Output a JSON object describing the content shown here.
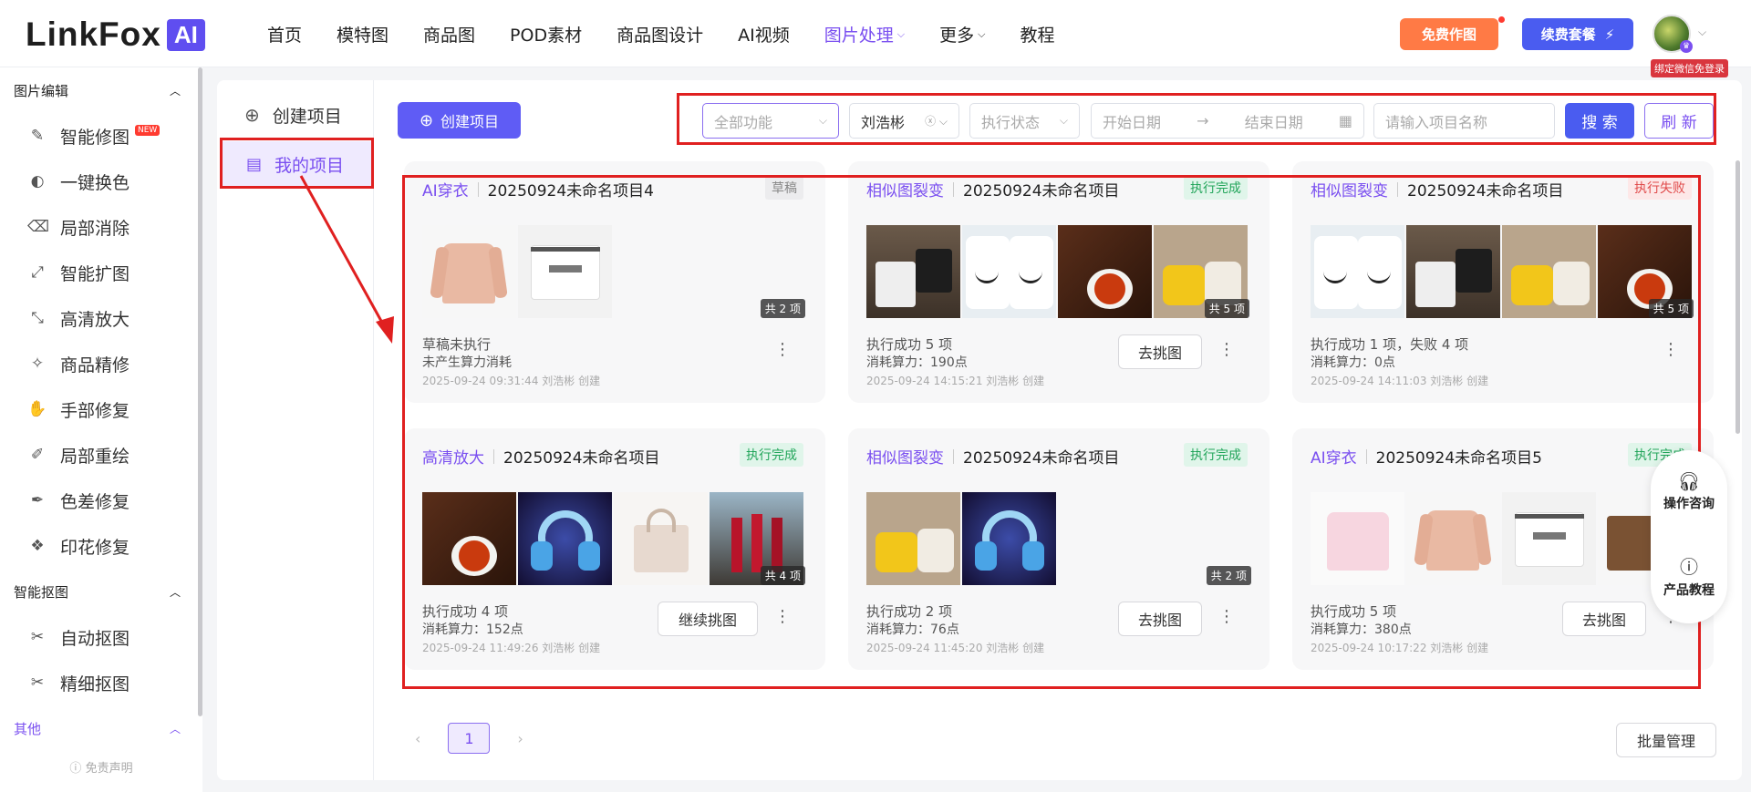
{
  "logo": {
    "text": "LinkFox",
    "badge": "AI"
  },
  "nav": [
    {
      "label": "首页",
      "chevron": false,
      "active": false
    },
    {
      "label": "模特图",
      "chevron": false,
      "active": false
    },
    {
      "label": "商品图",
      "chevron": false,
      "active": false
    },
    {
      "label": "POD素材",
      "chevron": false,
      "active": false
    },
    {
      "label": "商品图设计",
      "chevron": false,
      "active": false
    },
    {
      "label": "AI视频",
      "chevron": false,
      "active": false
    },
    {
      "label": "图片处理",
      "chevron": true,
      "active": true
    },
    {
      "label": "更多",
      "chevron": true,
      "active": false
    },
    {
      "label": "教程",
      "chevron": false,
      "active": false
    }
  ],
  "header": {
    "free_btn": "免费作图",
    "renew_btn": "续费套餐",
    "renew_icon": "⚡",
    "bind_tag": "绑定微信免登录"
  },
  "sidebar": {
    "section1": "图片编辑",
    "items1": [
      {
        "label": "智能修图",
        "icon": "✎",
        "new": "NEW"
      },
      {
        "label": "一键换色",
        "icon": "◐"
      },
      {
        "label": "局部消除",
        "icon": "⌫"
      },
      {
        "label": "智能扩图",
        "icon": "⤢"
      },
      {
        "label": "高清放大",
        "icon": "⤡"
      },
      {
        "label": "商品精修",
        "icon": "✧"
      },
      {
        "label": "手部修复",
        "icon": "✋"
      },
      {
        "label": "局部重绘",
        "icon": "✐"
      },
      {
        "label": "色差修复",
        "icon": "✒"
      },
      {
        "label": "印花修复",
        "icon": "❖"
      }
    ],
    "section2": "智能抠图",
    "items2": [
      {
        "label": "自动抠图",
        "icon": "✂"
      },
      {
        "label": "精细抠图",
        "icon": "✂"
      }
    ],
    "section3": "其他",
    "disclaimer": "免责声明"
  },
  "subnav": {
    "create": "创建项目",
    "mine": "我的项目"
  },
  "toolbar": {
    "create_btn": "创建项目",
    "filter_all": "全部功能",
    "filter_user": "刘浩彬",
    "filter_status": "执行状态",
    "start_date": "开始日期",
    "end_date": "结束日期",
    "name_placeholder": "请输入项目名称",
    "search": "搜 索",
    "refresh": "刷 新"
  },
  "cards": [
    {
      "type": "AI穿衣",
      "name": "20250924未命名项目4",
      "status": "草稿",
      "count": "共 2 项",
      "line1": "草稿未执行",
      "line2": "未产生算力消耗",
      "meta": "2025-09-24 09:31:44 刘浩彬 创建",
      "action": ""
    },
    {
      "type": "相似图裂变",
      "name": "20250924未命名项目",
      "status": "执行完成",
      "count": "共 5 项",
      "line1": "执行成功 5 项",
      "line2": "消耗算力：190点",
      "meta": "2025-09-24 14:15:21 刘浩彬 创建",
      "action": "去挑图"
    },
    {
      "type": "相似图裂变",
      "name": "20250924未命名项目",
      "status": "执行失败",
      "count": "共 5 项",
      "line1": "执行成功 1 项，失败 4 项",
      "line2": "消耗算力：0点",
      "meta": "2025-09-24 14:11:03 刘浩彬 创建",
      "action": ""
    },
    {
      "type": "高清放大",
      "name": "20250924未命名项目",
      "status": "执行完成",
      "count": "共 4 项",
      "line1": "执行成功 4 项",
      "line2": "消耗算力：152点",
      "meta": "2025-09-24 11:49:26 刘浩彬 创建",
      "action": "继续挑图"
    },
    {
      "type": "相似图裂变",
      "name": "20250924未命名项目",
      "status": "执行完成",
      "count": "共 2 项",
      "line1": "执行成功 2 项",
      "line2": "消耗算力：76点",
      "meta": "2025-09-24 11:45:20 刘浩彬 创建",
      "action": "去挑图"
    },
    {
      "type": "AI穿衣",
      "name": "20250924未命名项目5",
      "status": "执行完成",
      "count": "",
      "line1": "执行成功 5 项",
      "line2": "消耗算力：380点",
      "meta": "2025-09-24 10:17:22 刘浩彬 创建",
      "action": "去挑图"
    }
  ],
  "float": {
    "consult": "操作咨询",
    "tutorial": "产品教程"
  },
  "pager": {
    "prev": "‹",
    "page": "1",
    "next": "›"
  },
  "batch_btn": "批量管理"
}
